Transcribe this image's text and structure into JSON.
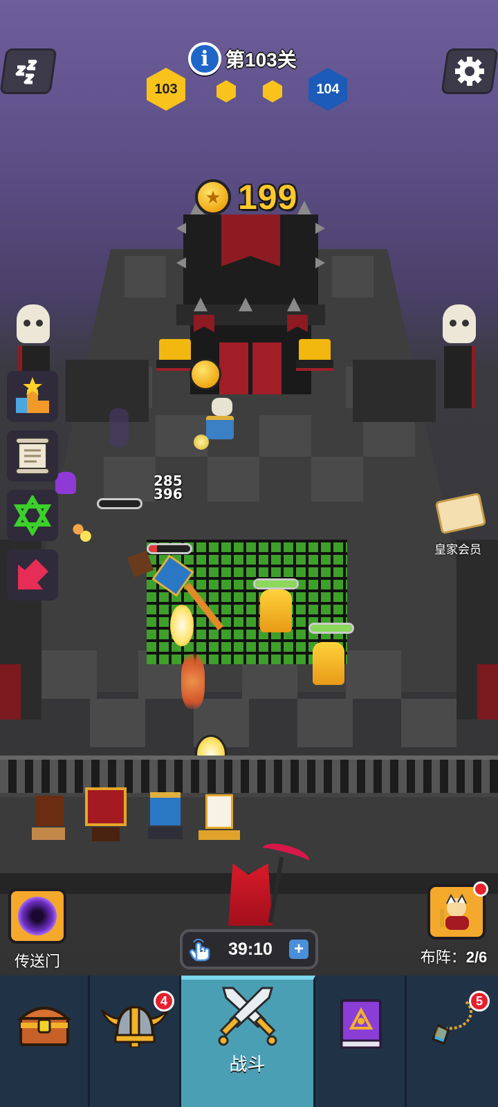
{
  "hud": {
    "sleep_icon": "sleep-zzz-icon",
    "info_icon": "i",
    "level_title": "第103关",
    "current_level": "103",
    "next_level": "104",
    "settings_icon": "gear-icon"
  },
  "coins": {
    "count": "199",
    "icon": "gold-coin-icon"
  },
  "side_menu": [
    {
      "name": "rank-trophy-icon"
    },
    {
      "name": "scroll-icon"
    },
    {
      "name": "hexagram-icon"
    },
    {
      "name": "red-arrow-icon"
    }
  ],
  "royal_member": {
    "label": "皇家会员"
  },
  "damage_numbers": [
    "285",
    "396"
  ],
  "enemy_health": [
    1.0,
    1.0,
    0.2
  ],
  "portal": {
    "label": "传送门",
    "icon": "black-hole-icon"
  },
  "timer": {
    "value": "39:10",
    "plus": "+",
    "icon": "tap-hand-icon"
  },
  "formation": {
    "label": "布阵：",
    "count": "2/6"
  },
  "nav": {
    "tabs": [
      {
        "name": "chest",
        "icon": "treasure-chest-icon",
        "badge": ""
      },
      {
        "name": "heroes",
        "icon": "viking-helmet-icon",
        "badge": "4"
      },
      {
        "name": "battle",
        "icon": "crossed-swords-icon",
        "label": "战斗",
        "badge": ""
      },
      {
        "name": "spellbook",
        "icon": "spellbook-icon",
        "badge": ""
      },
      {
        "name": "amulet",
        "icon": "amulet-icon",
        "badge": "5"
      }
    ]
  },
  "colors": {
    "gold": "#f9c31c",
    "blue_hex": "#1c5bb8",
    "nav_bg": "#203246",
    "nav_active": "#4b9fb5",
    "badge_red": "#e4212d"
  }
}
